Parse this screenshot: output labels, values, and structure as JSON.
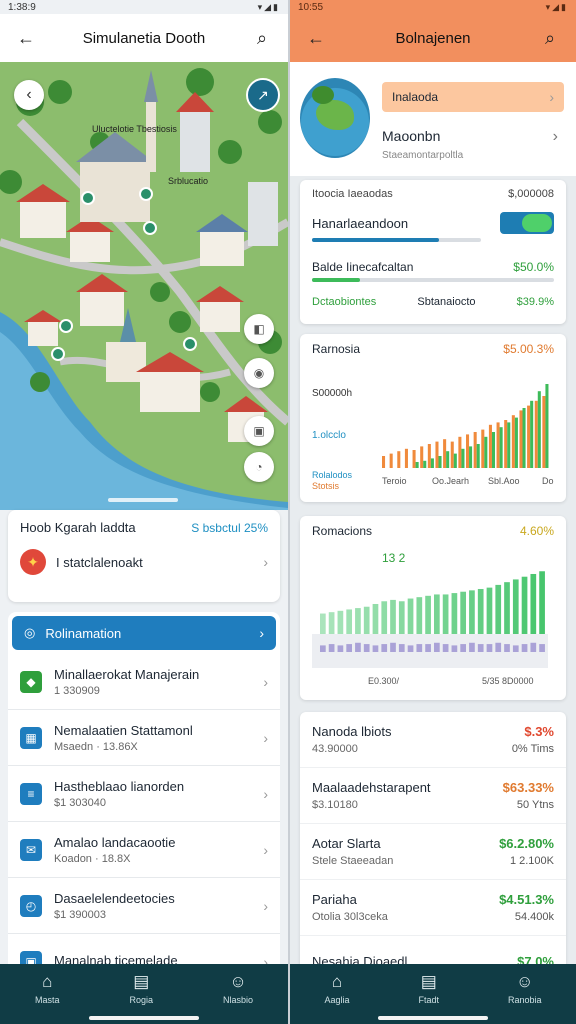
{
  "left": {
    "status": {
      "time": "1:38:9"
    },
    "appbar": {
      "title": "Simulanetia Dooth"
    },
    "map": {
      "labels": [
        "Uluctelotie Tbestiosis",
        "Srblucatio"
      ]
    },
    "summary": {
      "label": "Hoob Kgarah laddta",
      "value": "S bsbctul 25%",
      "item": "I statclalenoakt"
    },
    "list": {
      "header": "Rolinamation",
      "items": [
        {
          "title": "Minallaerokat Manajerain",
          "sub": "1 330909",
          "icon_color": "#2f9f3c",
          "icon": "map-pin-icon"
        },
        {
          "title": "Nemalaatien Stattamonl",
          "sub": "Msaedn · 13.86X",
          "icon_color": "#1f7dbe",
          "icon": "building-icon"
        },
        {
          "title": "Hastheblaao lianorden",
          "sub": "$1 303040",
          "icon_color": "#1f7dbe",
          "icon": "document-icon"
        },
        {
          "title": "Amalao landacaootie",
          "sub": "Koadon · 18.8X",
          "icon_color": "#1f7dbe",
          "icon": "mail-icon"
        },
        {
          "title": "Dasaelelendeetocies",
          "sub": "$1 390003",
          "icon_color": "#1f7dbe",
          "icon": "clock-icon"
        },
        {
          "title": "Manalnab ticemelade",
          "sub": "",
          "icon_color": "#1f7dbe",
          "icon": "calendar-icon"
        }
      ]
    },
    "nav": [
      {
        "label": "Masta",
        "icon": "home-icon"
      },
      {
        "label": "Rogia",
        "icon": "report-icon"
      },
      {
        "label": "Nlasbio",
        "icon": "profile-icon"
      }
    ]
  },
  "right": {
    "status": {
      "time": "10:55"
    },
    "appbar": {
      "title": "Bolnajenen"
    },
    "profile": {
      "pill": "Inalaoda",
      "name": "Maoonbn",
      "sub": "Staeamontarpoltla"
    },
    "stats": {
      "header_left": "Itoocia Iaeaodas",
      "header_right": "$,000008",
      "toggle_label": "Hanarlaeandoon",
      "row2_label": "Balde Iinecafcaltan",
      "row2_value": "$50.0%",
      "row3_label": "Dctaobiontes",
      "row3_mid": "Sbtanaiocto",
      "row3_value": "$39.9%",
      "progress": [
        0.75,
        0.2
      ]
    },
    "chart1": {
      "title": "Rarnosia",
      "value": "$5.00.3%",
      "y_label_1": "S00000h",
      "y_label_2": "1.olcclo",
      "legend_1": "Rolalodos",
      "legend_2": "Stotsis",
      "x_labels": [
        "Teroio",
        "Oo.Jearh",
        "Sbl.Aoo",
        "Dol"
      ]
    },
    "chart2": {
      "title": "Romacions",
      "value": "4.60%",
      "badge": "13 2",
      "x_labels": [
        "E0.300/",
        "5/35 8D0000"
      ]
    },
    "finance": [
      {
        "title": "Nanoda lbiots",
        "sub": "43.90000",
        "v1": "$.3%",
        "v2": "0%\nTims",
        "color": "#e0482f"
      },
      {
        "title": "Maalaadehstarapent",
        "sub": "$3.10180",
        "v1": "$63.33%",
        "v2": "50 Ytns",
        "color": "#e07a2f"
      },
      {
        "title": "Aotar Slarta",
        "sub": "Stele Staeeadan",
        "v1": "$6.2.80%",
        "v2": "1  2.100K",
        "color": "#2f9f3c"
      },
      {
        "title": "Pariaha",
        "sub": "Otolia 30l3ceka",
        "v1": "$4.51.3%",
        "v2": "54.400k",
        "color": "#2f9f3c"
      },
      {
        "title": "Nesahia Dioaedl",
        "sub": "",
        "v1": "$7.0%",
        "v2": "",
        "color": "#2f9f3c"
      }
    ],
    "nav": [
      {
        "label": "Aaglia",
        "icon": "home-icon"
      },
      {
        "label": "Ftadt",
        "icon": "report-icon"
      },
      {
        "label": "Ranobia",
        "icon": "profile-icon"
      }
    ]
  },
  "chart_data": [
    {
      "type": "bar",
      "title": "Rarnosia",
      "categories": [
        "1",
        "2",
        "3",
        "4",
        "5",
        "6",
        "7",
        "8",
        "9",
        "10",
        "11",
        "12",
        "13",
        "14",
        "15",
        "16",
        "17",
        "18",
        "19",
        "20",
        "21",
        "22"
      ],
      "series": [
        {
          "name": "",
          "color": "#f08a3c",
          "values": [
            10,
            12,
            14,
            16,
            15,
            18,
            20,
            22,
            24,
            22,
            26,
            28,
            30,
            32,
            36,
            38,
            40,
            44,
            48,
            52,
            56,
            60
          ]
        },
        {
          "name": "",
          "color": "#3dbb5a",
          "values": [
            0,
            0,
            0,
            0,
            5,
            6,
            8,
            10,
            14,
            12,
            16,
            18,
            20,
            26,
            30,
            34,
            38,
            42,
            50,
            56,
            64,
            70
          ]
        }
      ]
    },
    {
      "type": "bar",
      "title": "Romacions",
      "categories": [
        "1",
        "2",
        "3",
        "4",
        "5",
        "6",
        "7",
        "8",
        "9",
        "10",
        "11",
        "12",
        "13",
        "14",
        "15",
        "16",
        "17",
        "18",
        "19",
        "20",
        "21",
        "22",
        "23",
        "24",
        "25",
        "26"
      ],
      "series": [
        {
          "name": "",
          "color": "#43c46a",
          "values": [
            30,
            32,
            34,
            36,
            38,
            40,
            44,
            48,
            50,
            48,
            52,
            54,
            56,
            58,
            58,
            60,
            62,
            64,
            66,
            68,
            72,
            76,
            80,
            84,
            88,
            92
          ]
        },
        {
          "name": "",
          "color": "#9a8ed0",
          "values": [
            10,
            12,
            10,
            12,
            14,
            12,
            10,
            12,
            14,
            12,
            10,
            12,
            12,
            14,
            12,
            10,
            12,
            14,
            12,
            12,
            14,
            12,
            10,
            12,
            14,
            12
          ]
        }
      ]
    }
  ]
}
